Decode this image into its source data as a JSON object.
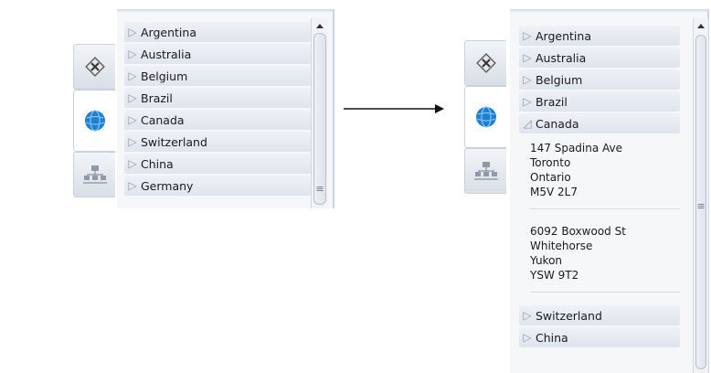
{
  "before": {
    "countries": [
      {
        "name": "Argentina",
        "state": "collapsed"
      },
      {
        "name": "Australia",
        "state": "collapsed"
      },
      {
        "name": "Belgium",
        "state": "collapsed"
      },
      {
        "name": "Brazil",
        "state": "collapsed"
      },
      {
        "name": "Canada",
        "state": "collapsed"
      },
      {
        "name": "Switzerland",
        "state": "collapsed"
      },
      {
        "name": "China",
        "state": "collapsed"
      },
      {
        "name": "Germany",
        "state": "collapsed"
      }
    ]
  },
  "after": {
    "countries_before": [
      {
        "name": "Argentina",
        "state": "collapsed"
      },
      {
        "name": "Australia",
        "state": "collapsed"
      },
      {
        "name": "Belgium",
        "state": "collapsed"
      },
      {
        "name": "Brazil",
        "state": "collapsed"
      }
    ],
    "expanded_country": {
      "name": "Canada",
      "state": "expanded"
    },
    "addresses": [
      {
        "line1": "147 Spadina Ave",
        "line2": "Toronto",
        "line3": "Ontario",
        "line4": "M5V 2L7"
      },
      {
        "line1": "6092 Boxwood St",
        "line2": "Whitehorse",
        "line3": "Yukon",
        "line4": "YSW 9T2"
      }
    ],
    "countries_after": [
      {
        "name": "Switzerland",
        "state": "collapsed"
      },
      {
        "name": "China",
        "state": "collapsed"
      }
    ]
  },
  "tabs": [
    {
      "icon": "tools-icon",
      "selected": false
    },
    {
      "icon": "globe-icon",
      "selected": true
    },
    {
      "icon": "network-icon",
      "selected": false
    }
  ],
  "icons": {
    "collapsed": "▷",
    "expanded": "◿"
  },
  "colors": {
    "row_fill": "#e4e9f0",
    "chevron": "#8a9bb0",
    "globe": "#1f7fd1",
    "border": "#c8d6e6"
  }
}
